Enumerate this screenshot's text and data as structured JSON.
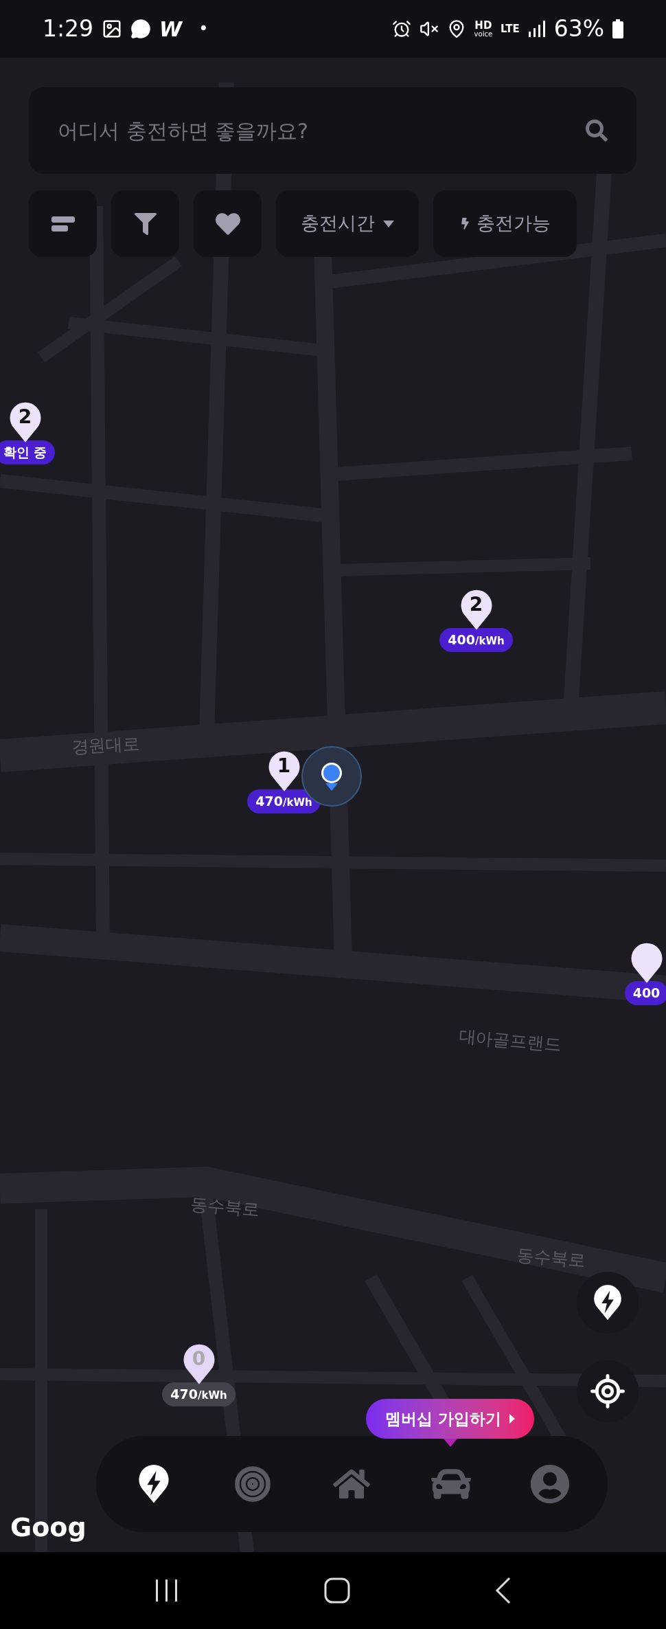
{
  "status_bar": {
    "time": "1:29",
    "app_letter": "W",
    "dot": "•",
    "hd": "HD",
    "voice": "voice",
    "network": "LTE",
    "battery": "63%"
  },
  "search": {
    "placeholder": "어디서 충전하면 좋을까요?"
  },
  "filters": [
    {
      "kind": "sort"
    },
    {
      "kind": "filter"
    },
    {
      "kind": "favorite"
    },
    {
      "kind": "dropdown",
      "label": "충전시간"
    },
    {
      "kind": "toggle",
      "label": "충전가능"
    }
  ],
  "road_labels": [
    "경원대로",
    "대아골프랜드",
    "동수북로",
    "동수북로"
  ],
  "markers": [
    {
      "count": "2",
      "price": "확인 중",
      "available": true
    },
    {
      "count": "2",
      "price": "400",
      "unit": "/kWh",
      "available": true
    },
    {
      "count": "1",
      "price": "470",
      "unit": "/kWh",
      "available": true
    },
    {
      "price": "400",
      "available": true
    },
    {
      "count": "0",
      "price": "470",
      "unit": "/kWh",
      "available": false
    }
  ],
  "membership_bubble": {
    "label": "멤버십 가입하기"
  },
  "map_attribution": "Goog",
  "bottom_nav": [
    {
      "kind": "charge",
      "selected": true
    },
    {
      "kind": "target",
      "selected": false
    },
    {
      "kind": "home",
      "selected": false
    },
    {
      "kind": "car",
      "selected": false
    },
    {
      "kind": "profile",
      "selected": false
    }
  ]
}
